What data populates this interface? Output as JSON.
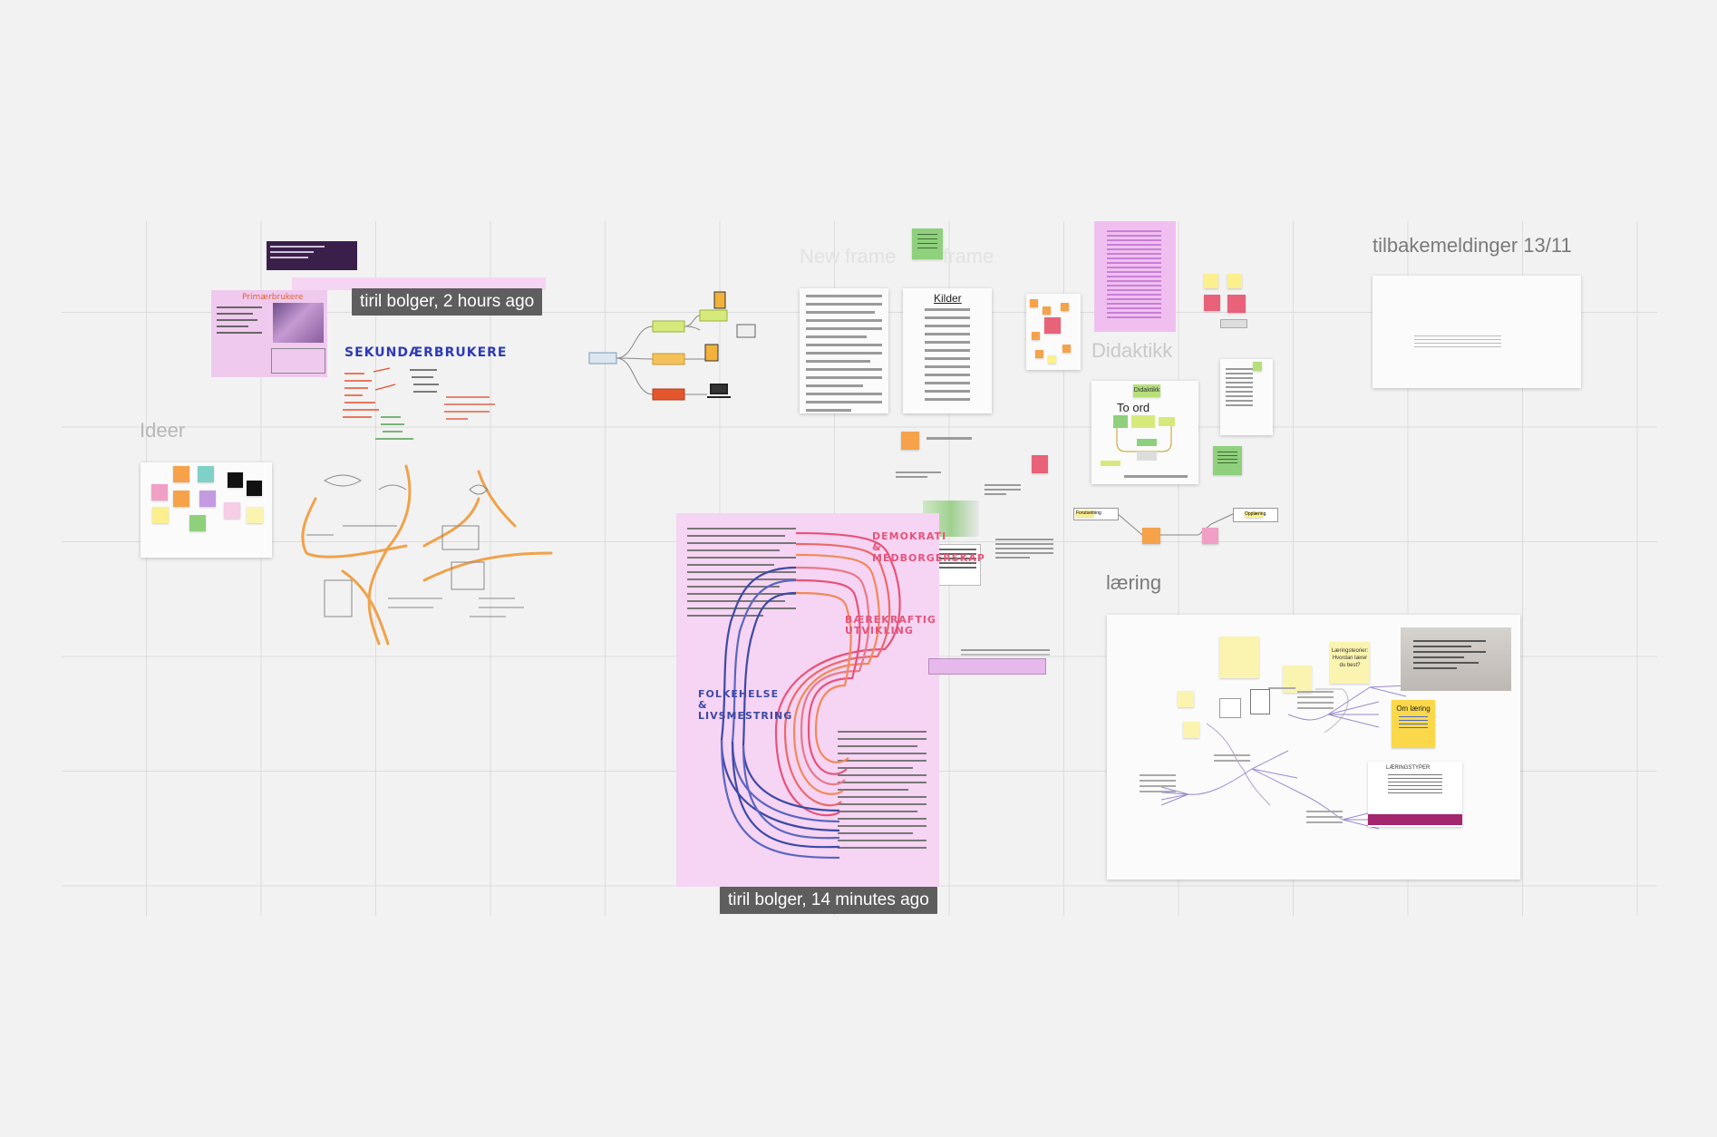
{
  "board": {
    "frames": {
      "ideer": "Ideer",
      "new_frame": "New frame",
      "frame": "frame",
      "didaktikk": "Didaktikk",
      "tilbakemeldinger": "tilbakemeldinger 13/11",
      "laering": "læring"
    },
    "cursors": {
      "user_top": "tiril bolger, 2 hours ago",
      "user_bottom": "tiril bolger, 14 minutes ago"
    },
    "labels": {
      "kilder": "Kilder",
      "to_ord": "To ord",
      "didaktikk_small": "Didaktikk",
      "sekundaer": "SEKUNDÆRBRUKERE",
      "primaer": "Primærbrukere",
      "demokrati": "DEMOKRATI & MEDBORGERSKAP",
      "baerekraftig": "BÆREKRAFTIG UTVIKLING",
      "folkehelse": "FOLKEHELSE & LIVSMESTRING",
      "om_laering": "Om læring",
      "laeringsteori": "Læringsteorier: Hvordan lærer du best?",
      "laeringsstyrer": "LÆRINGSTYPER",
      "forutsetning": "Forutsetning",
      "opplaring": "Opplæring"
    },
    "colors": {
      "canvas": "#f2f2f2",
      "pink_frame": "#f6d4f3",
      "cursor_tag": "#5e5e5e",
      "sticky_orange": "#f5a24a",
      "sticky_teal": "#7fd1c8",
      "sticky_pink": "#f0a0c4",
      "sticky_yellow": "#fbef8e",
      "sticky_green": "#8fd07d",
      "sticky_purple": "#c39be0",
      "sticky_red": "#e8627a"
    }
  }
}
